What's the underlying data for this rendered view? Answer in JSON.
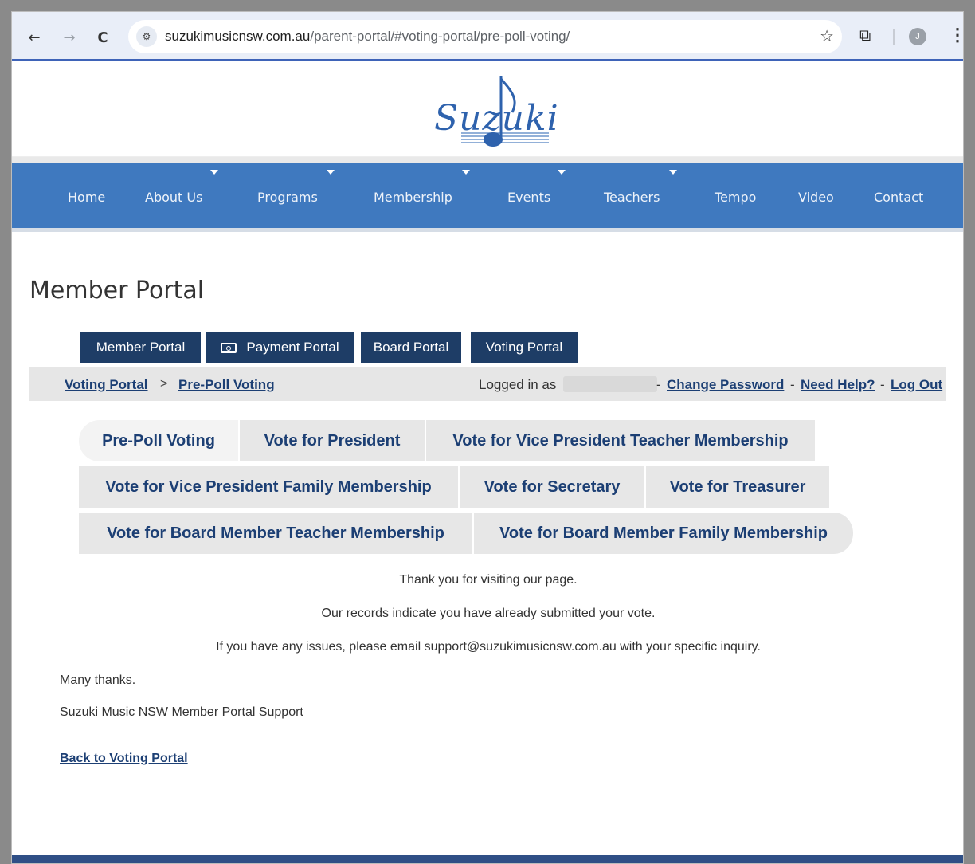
{
  "browser": {
    "back_icon": "←",
    "forward_icon": "→",
    "reload_icon": "C",
    "site_info_icon": "⚙",
    "url_host": "suzukimusicnsw.com.au",
    "url_path": "/parent-portal/#voting-portal/pre-poll-voting/",
    "bookmark_icon": "☆",
    "extensions_icon": "⧉",
    "profile_initial": "J",
    "menu_icon": "⋮"
  },
  "site": {
    "logo_text": "Suzuki",
    "nav": [
      "Home",
      "About Us",
      "Programs",
      "Membership",
      "Events",
      "Teachers",
      "Tempo",
      "Video",
      "Contact"
    ]
  },
  "page": {
    "title": "Member Portal",
    "portal_tabs": [
      "Member Portal",
      "Payment Portal",
      "Board Portal",
      "Voting Portal"
    ],
    "breadcrumb": {
      "root": "Voting Portal",
      "separator": ">",
      "current": "Pre-Poll Voting"
    },
    "account": {
      "logged_in_label": "Logged in as",
      "dash": "-",
      "change_password": "Change Password",
      "need_help": "Need Help?",
      "log_out": "Log Out"
    },
    "vote_tabs": [
      "Pre-Poll Voting",
      "Vote for President",
      "Vote for Vice President Teacher Membership",
      "Vote for Vice President Family Membership",
      "Vote for Secretary",
      "Vote for Treasurer",
      "Vote for Board Member Teacher Membership",
      "Vote for Board Member Family Membership"
    ],
    "messages": {
      "thanks": "Thank you for visiting our page.",
      "records": "Our records indicate you have already submitted your vote.",
      "issues": "If you have any issues, please email support@suzukimusicnsw.com.au with your specific inquiry.",
      "many_thanks": "Many thanks.",
      "signature": "Suzuki Music NSW Member Portal Support"
    },
    "back_link": "Back to Voting Portal"
  },
  "colors": {
    "nav_blue": "#3f79bf",
    "portal_tab_navy": "#1e3d66",
    "link_navy": "#1c3f74",
    "logo_blue": "#2e62ad"
  }
}
